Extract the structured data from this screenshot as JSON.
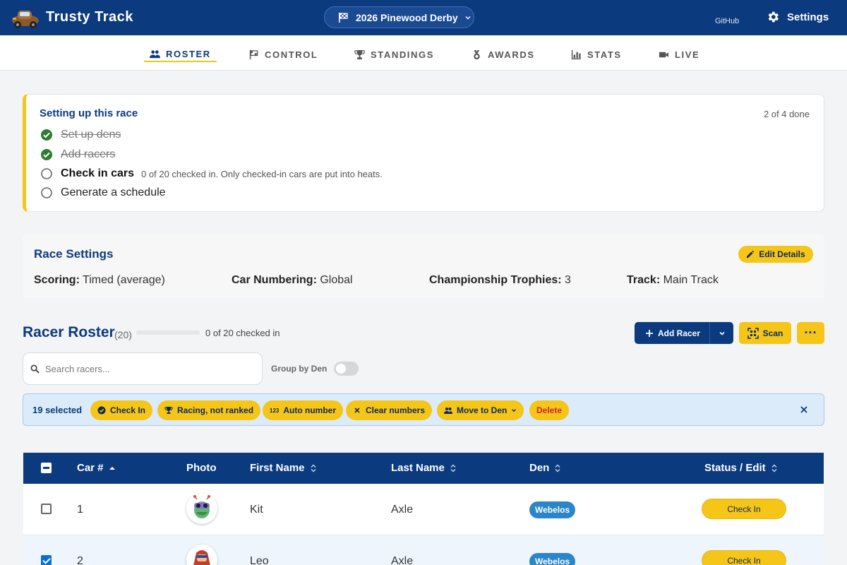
{
  "header": {
    "app_title": "Trusty Track",
    "race_selector": "2026 Pinewood Derby",
    "github_label": "GitHub",
    "settings_label": "Settings"
  },
  "nav": {
    "tabs": [
      {
        "label": "ROSTER",
        "icon": "users-icon",
        "active": true
      },
      {
        "label": "CONTROL",
        "icon": "flag-icon"
      },
      {
        "label": "STANDINGS",
        "icon": "trophy-icon"
      },
      {
        "label": "AWARDS",
        "icon": "medal-icon"
      },
      {
        "label": "STATS",
        "icon": "bar-chart-icon"
      },
      {
        "label": "LIVE",
        "icon": "video-icon"
      }
    ]
  },
  "setup": {
    "title": "Setting up this race",
    "progress": "2 of 4 done",
    "steps": [
      {
        "label": "Set up dens",
        "done": true
      },
      {
        "label": "Add racers",
        "done": true
      },
      {
        "label": "Check in cars",
        "done": false,
        "note": "0 of 20 checked in. Only checked-in cars are put into heats."
      },
      {
        "label": "Generate a schedule",
        "done": false
      }
    ]
  },
  "race_settings": {
    "title": "Race Settings",
    "edit_label": "Edit Details",
    "items": [
      {
        "key": "Scoring:",
        "value": "Timed (average)"
      },
      {
        "key": "Car Numbering:",
        "value": "Global"
      },
      {
        "key": "Championship Trophies:",
        "value": "3"
      },
      {
        "key": "Track:",
        "value": "Main Track"
      }
    ]
  },
  "roster": {
    "title": "Racer Roster",
    "count": "(20)",
    "checked_in_text": "0 of 20 checked in",
    "checked_in_fraction": 0,
    "add_racer_label": "Add Racer",
    "scan_label": "Scan",
    "more_label": "···",
    "search_placeholder": "Search racers...",
    "group_by_label": "Group by Den",
    "group_by_on": false
  },
  "bulk": {
    "selected_text": "19 selected",
    "actions": [
      "Check In",
      "Racing, not ranked",
      "Auto number",
      "Clear numbers",
      "Move to Den",
      "Delete"
    ]
  },
  "table": {
    "columns": [
      "Car #",
      "Photo",
      "First Name",
      "Last Name",
      "Den",
      "Status / Edit"
    ],
    "rows": [
      {
        "car": "1",
        "first": "Kit",
        "last": "Axle",
        "den": "Webelos",
        "status": "Check In",
        "selected": false,
        "avatar": "alien-avatar"
      },
      {
        "car": "2",
        "first": "Leo",
        "last": "Axle",
        "den": "Webelos",
        "status": "Check In",
        "selected": true,
        "avatar": "hero-avatar"
      }
    ]
  },
  "colors": {
    "primary": "#0b3a7e",
    "accent": "#f5c518",
    "success": "#2e7d32",
    "den_badge": "#2a86c8"
  }
}
